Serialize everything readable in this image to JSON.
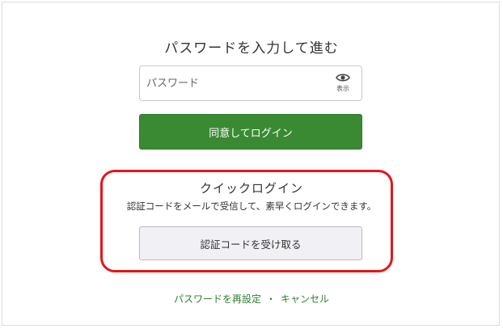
{
  "login": {
    "heading": "パスワードを入力して進む",
    "password_placeholder": "パスワード",
    "password_value": "",
    "show_label": "表示",
    "agree_button": "同意してログイン"
  },
  "quick_login": {
    "title": "クイックログイン",
    "description": "認証コードをメールで受信して、素早くログインできます。",
    "button": "認証コードを受け取る",
    "highlight_color": "#e8141a"
  },
  "footer": {
    "reset_link": "パスワードを再設定",
    "separator": "・",
    "cancel_link": "キャンセル"
  },
  "colors": {
    "primary_green": "#3a8a34",
    "link_green": "#2e7d2e"
  },
  "icons": {
    "show_password": "eye-icon"
  }
}
